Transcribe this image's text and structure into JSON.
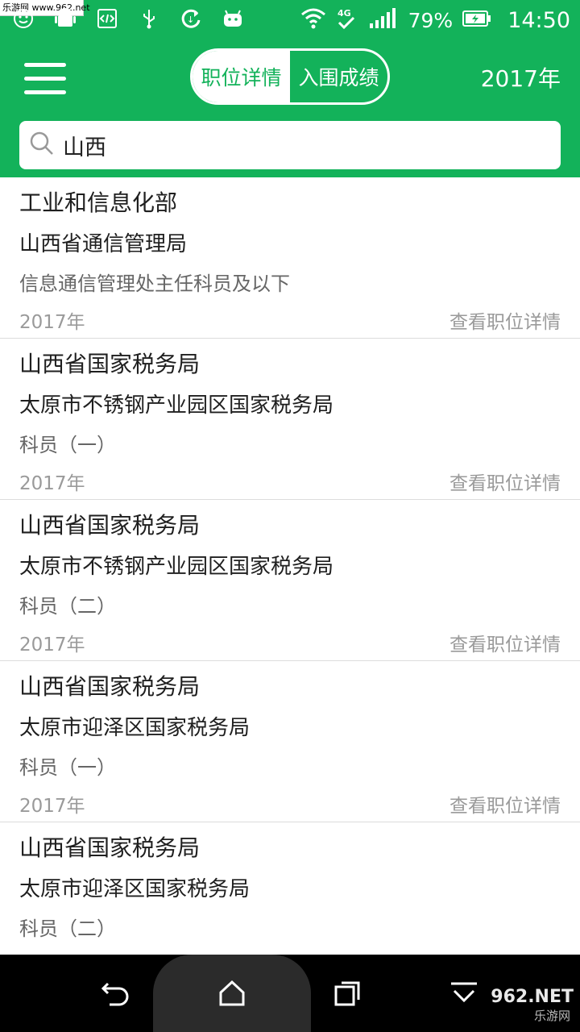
{
  "status_bar": {
    "watermark": "乐游网 www.962.net",
    "battery_percent": "79%",
    "time": "14:50",
    "network": "4G"
  },
  "header": {
    "tabs": [
      {
        "label": "职位详情",
        "active": true
      },
      {
        "label": "入围成绩",
        "active": false
      }
    ],
    "year": "2017年"
  },
  "search": {
    "value": "山西"
  },
  "results": [
    {
      "dept": "工业和信息化部",
      "org": "山西省通信管理局",
      "position": "信息通信管理处主任科员及以下",
      "year": "2017年",
      "link": "查看职位详情"
    },
    {
      "dept": "山西省国家税务局",
      "org": "太原市不锈钢产业园区国家税务局",
      "position": "科员（一）",
      "year": "2017年",
      "link": "查看职位详情"
    },
    {
      "dept": "山西省国家税务局",
      "org": "太原市不锈钢产业园区国家税务局",
      "position": "科员（二）",
      "year": "2017年",
      "link": "查看职位详情"
    },
    {
      "dept": "山西省国家税务局",
      "org": "太原市迎泽区国家税务局",
      "position": "科员（一）",
      "year": "2017年",
      "link": "查看职位详情"
    },
    {
      "dept": "山西省国家税务局",
      "org": "太原市迎泽区国家税务局",
      "position": "科员（二）",
      "year": "",
      "link": ""
    }
  ],
  "watermark_bottom": {
    "top": "962.NET",
    "bottom": "乐游网"
  },
  "colors": {
    "brand_green": "#13b25a",
    "muted_text": "#9a9a9a"
  }
}
